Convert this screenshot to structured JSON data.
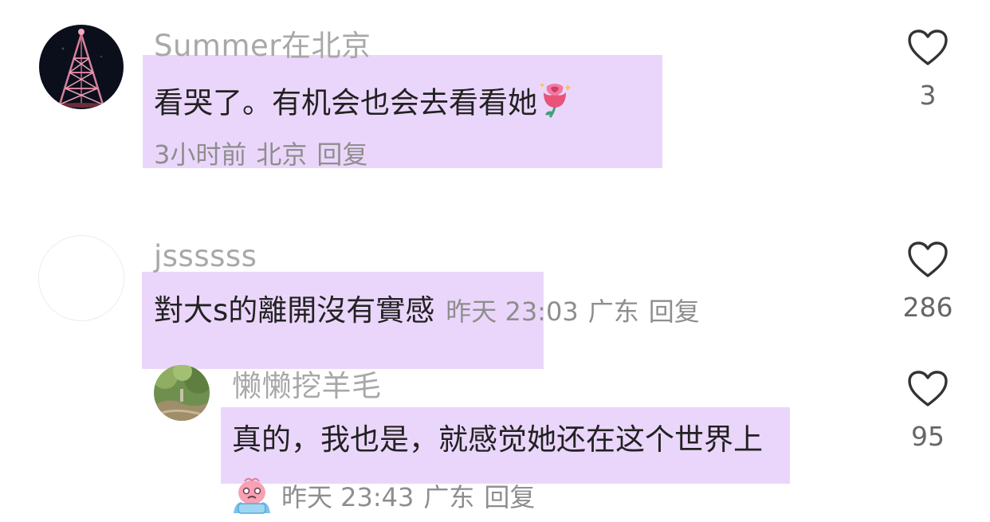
{
  "comments": [
    {
      "username": "Summer在北京",
      "content": "看哭了。有机会也会去看看她",
      "time": "3小时前",
      "location": "北京",
      "reply_label": "回复",
      "likes": "3",
      "emoji": "rose-emoji"
    },
    {
      "username": "jssssss",
      "content": "對大s的離開沒有實感",
      "time": "昨天 23:03",
      "location": "广东",
      "reply_label": "回复",
      "likes": "286"
    }
  ],
  "reply": {
    "username": "懒懒挖羊毛",
    "content": "真的，我也是，就感觉她还在这个世界上",
    "time": "昨天 23:43",
    "location": "广东",
    "reply_label": "回复",
    "likes": "95",
    "emoji": "crying-face-emoji"
  },
  "colors": {
    "highlight": "#e2c4fa",
    "username": "#a8a8a8",
    "content": "#222222",
    "meta": "#8e8e8e"
  }
}
